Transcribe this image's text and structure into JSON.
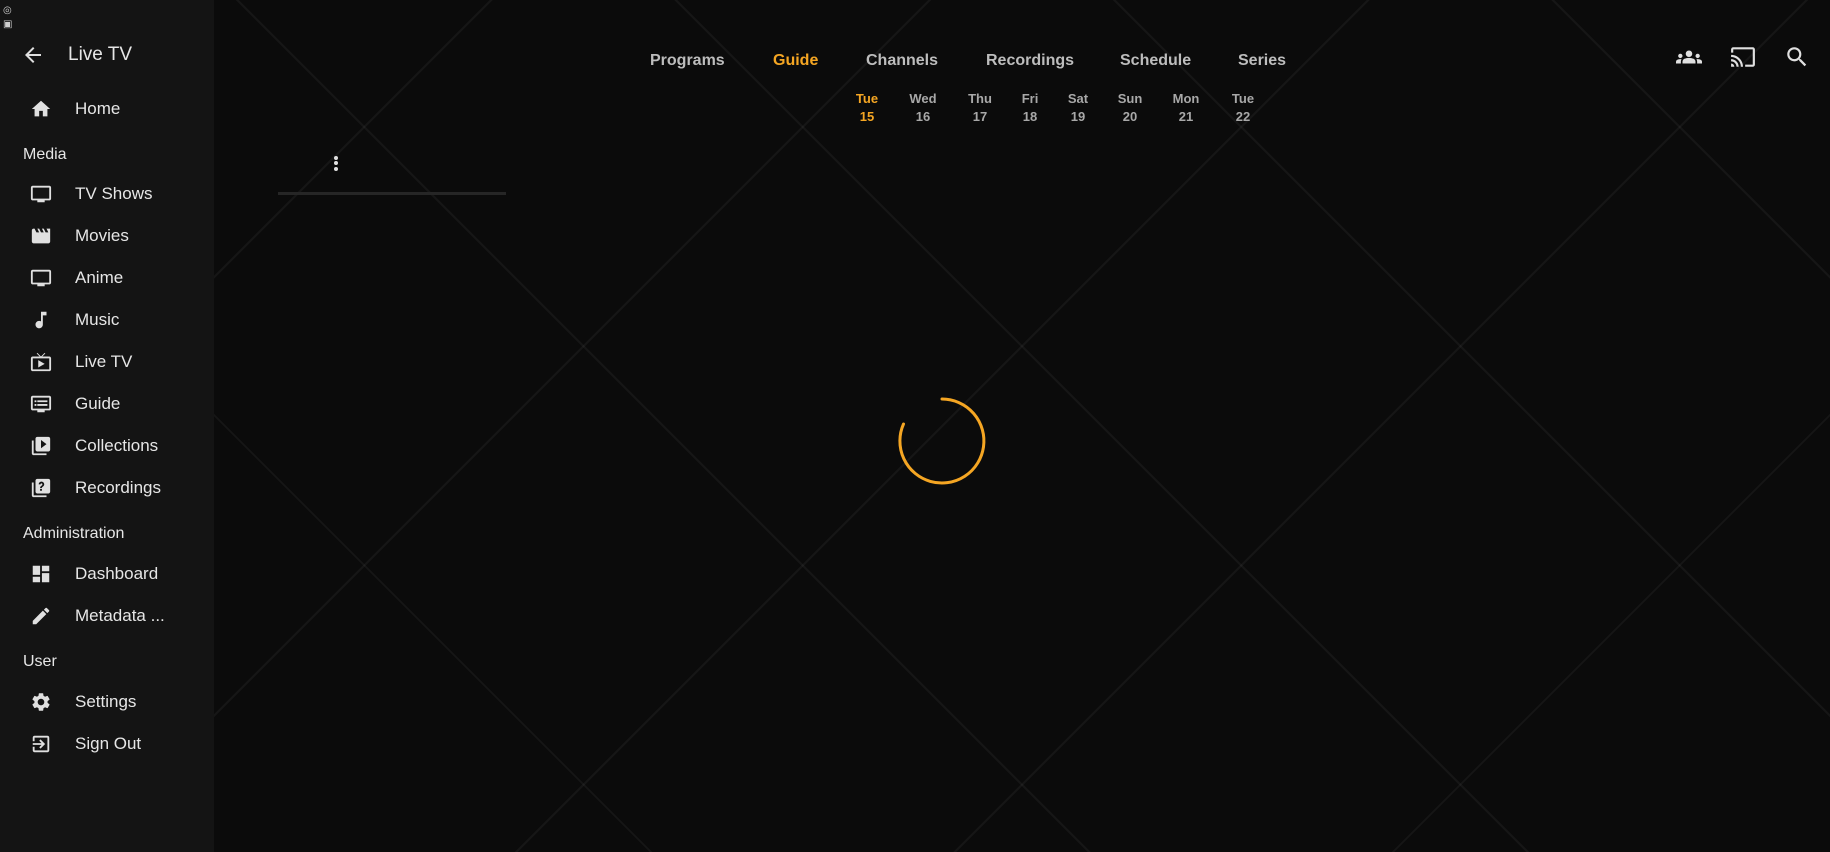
{
  "app": {
    "title": "Live TV",
    "accent_color": "#f5a623"
  },
  "sidebar": {
    "back_icon": "arrow-left-icon",
    "home": {
      "label": "Home",
      "icon": "home-icon"
    },
    "sections": [
      {
        "title": "Media",
        "items": [
          {
            "label": "TV Shows",
            "icon": "tv-icon"
          },
          {
            "label": "Movies",
            "icon": "movie-clapper-icon"
          },
          {
            "label": "Anime",
            "icon": "tv-icon"
          },
          {
            "label": "Music",
            "icon": "music-note-icon"
          },
          {
            "label": "Live TV",
            "icon": "live-tv-icon"
          },
          {
            "label": "Guide",
            "icon": "guide-icon"
          },
          {
            "label": "Collections",
            "icon": "collections-icon"
          },
          {
            "label": "Recordings",
            "icon": "recordings-icon"
          }
        ]
      },
      {
        "title": "Administration",
        "items": [
          {
            "label": "Dashboard",
            "icon": "dashboard-icon"
          },
          {
            "label": "Metadata ...",
            "icon": "pencil-icon"
          }
        ]
      },
      {
        "title": "User",
        "items": [
          {
            "label": "Settings",
            "icon": "gear-icon"
          },
          {
            "label": "Sign Out",
            "icon": "sign-out-icon"
          }
        ]
      }
    ]
  },
  "tabs": [
    {
      "label": "Programs",
      "active": false
    },
    {
      "label": "Guide",
      "active": true
    },
    {
      "label": "Channels",
      "active": false
    },
    {
      "label": "Recordings",
      "active": false
    },
    {
      "label": "Schedule",
      "active": false
    },
    {
      "label": "Series",
      "active": false
    }
  ],
  "days": [
    {
      "name": "Tue",
      "date": "15",
      "active": true
    },
    {
      "name": "Wed",
      "date": "16",
      "active": false
    },
    {
      "name": "Thu",
      "date": "17",
      "active": false
    },
    {
      "name": "Fri",
      "date": "18",
      "active": false
    },
    {
      "name": "Sat",
      "date": "19",
      "active": false
    },
    {
      "name": "Sun",
      "date": "20",
      "active": false
    },
    {
      "name": "Mon",
      "date": "21",
      "active": false
    },
    {
      "name": "Tue",
      "date": "22",
      "active": false
    }
  ],
  "header_icons": [
    "users-icon",
    "cast-icon",
    "search-icon"
  ],
  "guide": {
    "more_icon": "more-vertical-icon",
    "loading": true
  }
}
